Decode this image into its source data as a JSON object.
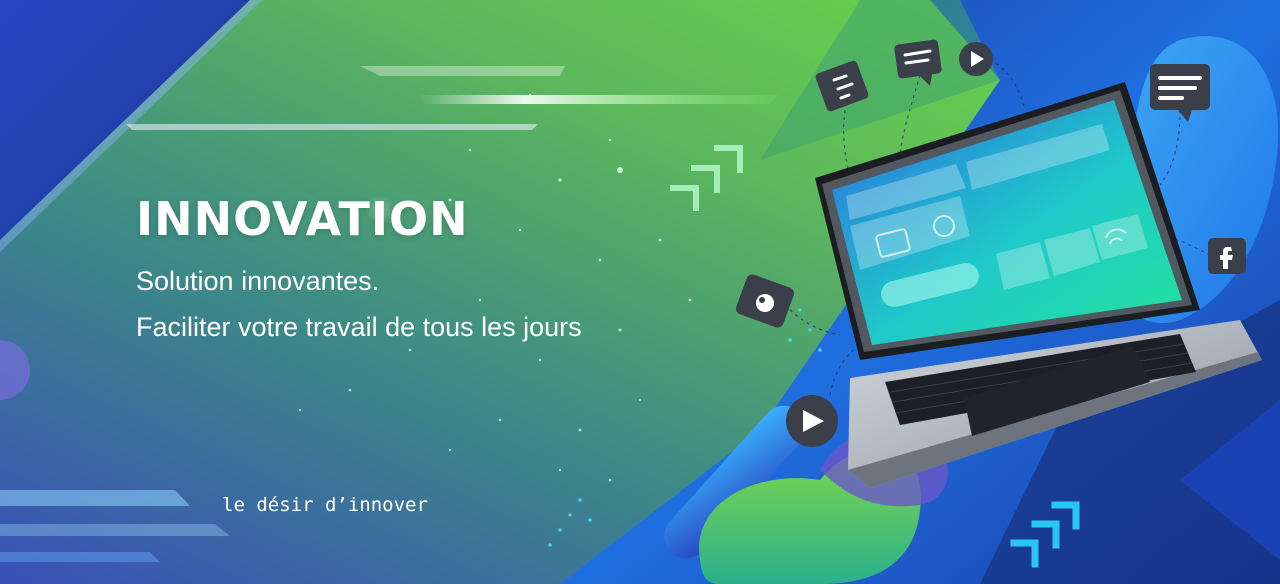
{
  "banner": {
    "headline": "INNOVATION",
    "subtitle_line1": "Solution innovantes.",
    "subtitle_line2": "Faciliter votre travail de tous les jours",
    "tagline": "le désir d’innover"
  },
  "icons": {
    "chat_bubble": "chat-bubble-icon",
    "play": "play-icon",
    "camera": "camera-icon",
    "facebook": "facebook-icon",
    "laptop": "laptop-illustration"
  },
  "colors": {
    "deep_blue": "#1f3fa8",
    "bright_blue": "#2d8df0",
    "green": "#5fcf4c",
    "teal": "#3e8a84",
    "cyan_arrow": "#28c7f0"
  }
}
